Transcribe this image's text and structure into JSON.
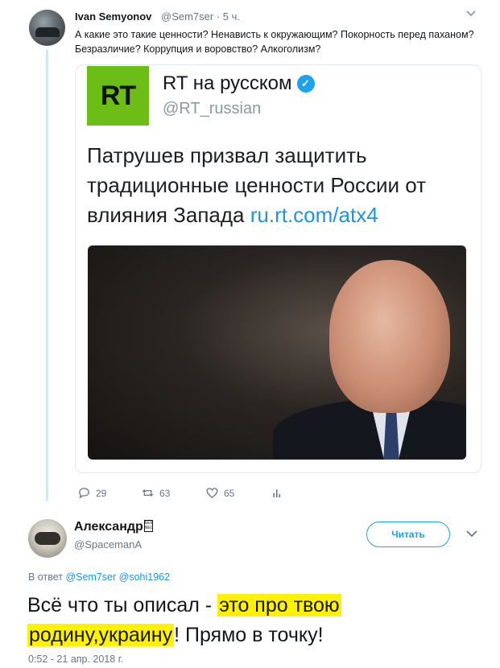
{
  "tweet1": {
    "name": "Ivan Semyonov",
    "handle": "@Sem7ser · 5 ч.",
    "text": "А какие это такие ценности? Ненависть к окружающим? Покорность перед паханом? Безразличие? Коррупция и воровство? Алкоголизм?",
    "avatar_icon": "user-avatar-photo",
    "caret_icon": "chevron-down-icon",
    "quoted": {
      "logo_text": "RT",
      "logo_color": "#6cbd16",
      "name": "RT на русском",
      "verified_icon": "verified-badge-icon",
      "handle": "@RT_russian",
      "text": "Патрушев призвал защитить традиционные ценности России от влияния Запада ",
      "link": "ru.rt.com/atx4",
      "photo_icon": "news-photo"
    },
    "actions": {
      "reply_count": "29",
      "retweet_count": "63",
      "like_count": "65"
    }
  },
  "tweet2": {
    "name": "Александр",
    "name_glyph": "EEE NEC",
    "handle": "@SpacemanA",
    "follow_label": "Читать",
    "reply_prefix": "В ответ ",
    "reply_user1": "@Sem7ser",
    "reply_user2": "@sohi1962",
    "text_part1": "Всё что ты описал - ",
    "text_highlight1": "это про твою",
    "text_highlight2": "родину,украину",
    "text_part2": "! Прямо в точку!",
    "timestamp": "0:52 - 21 апр. 2018 г.",
    "highlight_color": "#fff200",
    "accent_color": "#1da1f2"
  }
}
